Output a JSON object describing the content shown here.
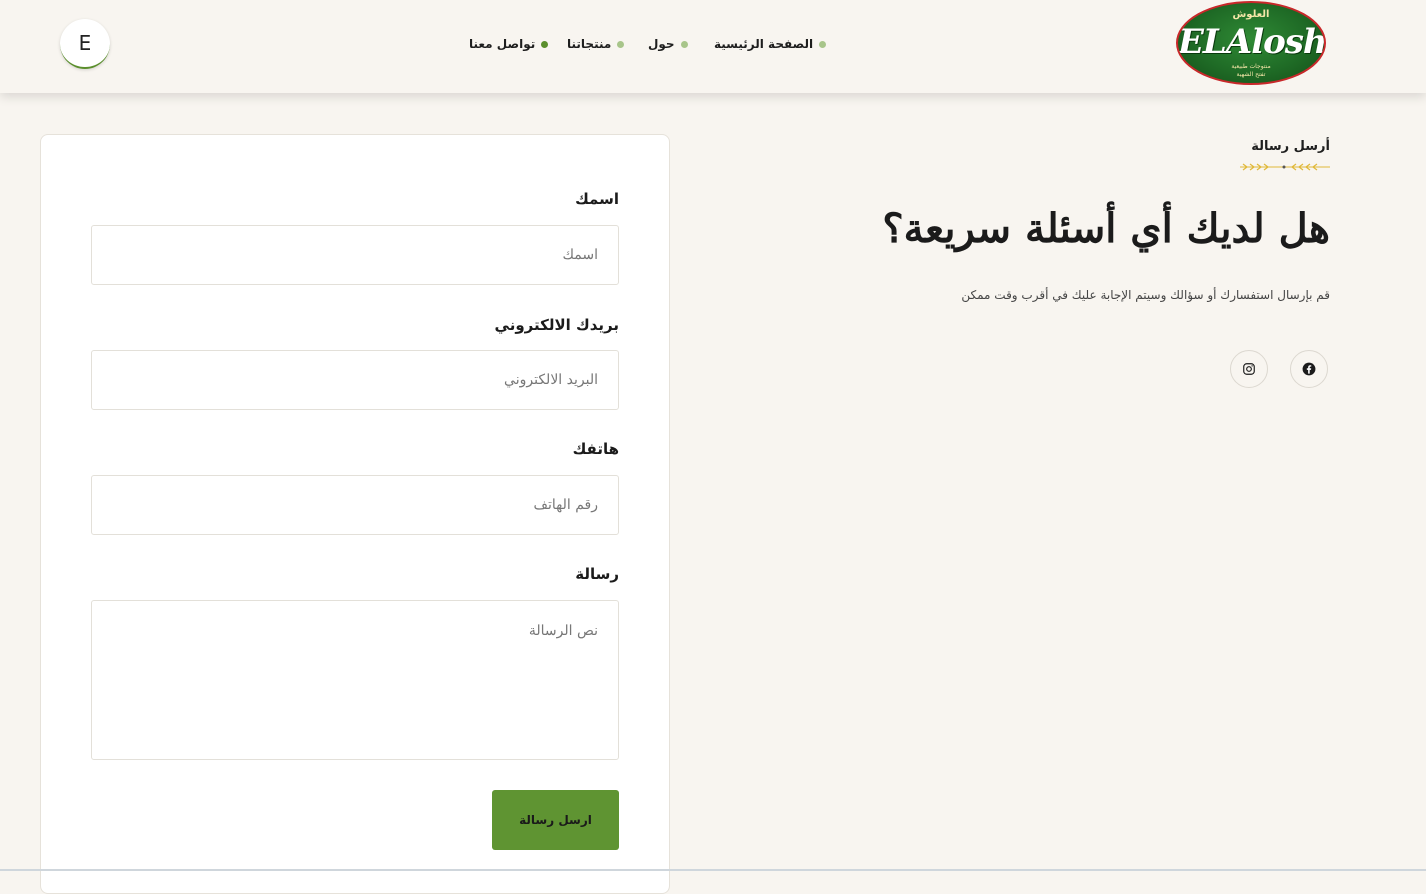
{
  "brand": {
    "name": "ELAlosh",
    "arabic_name": "العلوش",
    "tagline_1": "منتوجات طبيعية",
    "tagline_2": "تفتح الشهية",
    "colors": {
      "green": "#5f9432",
      "red": "#c8282a",
      "background": "#f8f5f0"
    }
  },
  "nav": {
    "items": [
      {
        "label": "الصفحة الرئيسية"
      },
      {
        "label": "حول"
      },
      {
        "label": "منتجاتنا"
      },
      {
        "label": "تواصل معنا",
        "active": true
      }
    ]
  },
  "user": {
    "avatar_initial": "E"
  },
  "intro": {
    "eyebrow": "أرسل رسالة",
    "headline": "هل لديك أي أسئلة سريعة؟",
    "subtitle": "قم بإرسال استفسارك أو سؤالك وسيتم الإجابة عليك في أقرب وقت ممكن",
    "socials": [
      {
        "icon": "facebook-icon"
      },
      {
        "icon": "instagram-icon"
      }
    ]
  },
  "form": {
    "name": {
      "label": "اسمك",
      "placeholder": "اسمك",
      "value": ""
    },
    "email": {
      "label": "بريدك الالكتروني",
      "placeholder": "البريد الالكتروني",
      "value": ""
    },
    "phone": {
      "label": "هاتفك",
      "placeholder": "رقم الهاتف",
      "value": ""
    },
    "message": {
      "label": "رسالة",
      "placeholder": "نص الرسالة",
      "value": ""
    },
    "submit_label": "ارسل رسالة"
  }
}
